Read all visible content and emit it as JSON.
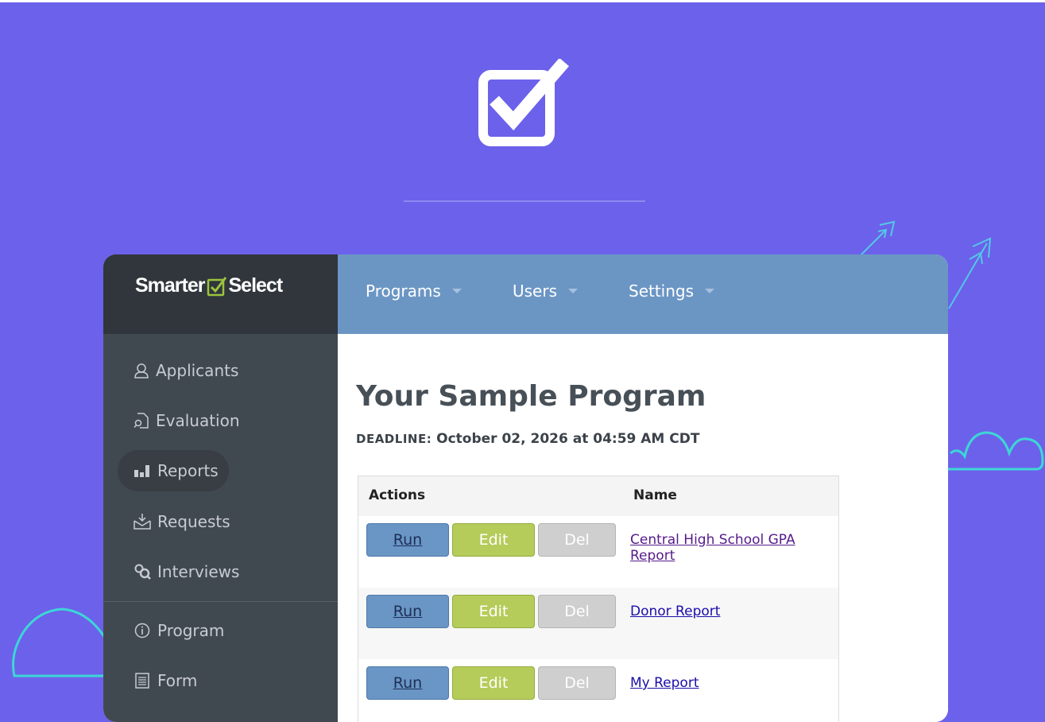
{
  "brand": {
    "left": "Smarter",
    "right": "Select"
  },
  "topnav": [
    {
      "label": "Programs"
    },
    {
      "label": "Users"
    },
    {
      "label": "Settings"
    }
  ],
  "sidebar": {
    "items": [
      {
        "label": "Applicants",
        "icon": "user-icon"
      },
      {
        "label": "Evaluation",
        "icon": "document-search-icon"
      },
      {
        "label": "Reports",
        "icon": "bar-chart-icon",
        "active": true
      },
      {
        "label": "Requests",
        "icon": "inbox-download-icon"
      },
      {
        "label": "Interviews",
        "icon": "interview-icon"
      },
      {
        "label": "Program",
        "icon": "info-icon"
      },
      {
        "label": "Form",
        "icon": "form-icon"
      }
    ]
  },
  "main": {
    "title": "Your Sample Program",
    "deadline_label": "DEADLINE:",
    "deadline_value": "October 02, 2026 at 04:59 AM CDT",
    "table": {
      "headers": [
        "Actions",
        "Name"
      ],
      "rows": [
        {
          "run": "Run",
          "edit": "Edit",
          "del": "Del",
          "name": "Central High School GPA Report"
        },
        {
          "run": "Run",
          "edit": "Edit",
          "del": "Del",
          "name": "Donor Report"
        },
        {
          "run": "Run",
          "edit": "Edit",
          "del": "Del",
          "name": "My Report"
        }
      ]
    }
  },
  "colors": {
    "background": "#6c61ea",
    "sidebar": "#414950",
    "brand_bar": "#30363c",
    "topbar": "#6b96c4",
    "accent_green": "#b5cc5a",
    "decoration_teal": "#3dd6d6"
  }
}
